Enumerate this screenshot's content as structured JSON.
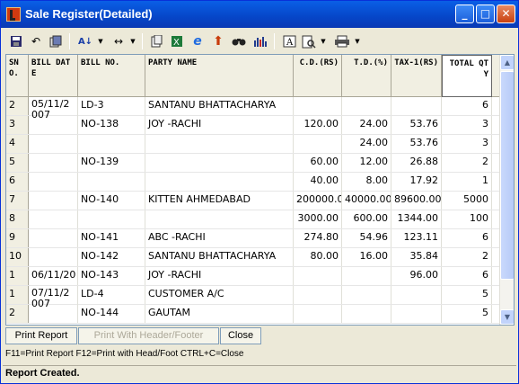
{
  "window": {
    "title": "Sale Register(Detailed)",
    "minimize_glyph": "_",
    "maximize_glyph": "□",
    "close_glyph": "✕"
  },
  "toolbar": {
    "icons": [
      "save-icon",
      "undo-icon",
      "copy-report-icon",
      "sort-icon",
      "dropdown-icon",
      "column-width-icon",
      "dropdown-icon",
      "clipboard-icon",
      "excel-icon",
      "internet-explorer-icon",
      "upload-arrow-icon",
      "find-binoculars-icon",
      "chart-icon",
      "text-format-icon",
      "print-preview-icon",
      "dropdown-icon",
      "printer-icon",
      "dropdown-icon"
    ]
  },
  "table": {
    "headers": {
      "sno": "SN O.",
      "bill_date": "BILL DATE",
      "bill_no": "BILL NO.",
      "party_name": "PARTY NAME",
      "cd": "C.D.(RS)",
      "td": "T.D.(%)",
      "tax": "TAX-1(RS)",
      "total_qty": "TOTAL QTY"
    },
    "rows": [
      {
        "sno": "2",
        "date": "05/11/2007",
        "bill": "LD-3",
        "party": "SANTANU BHATTACHARYA",
        "cd": "",
        "td": "",
        "tax": "",
        "qty": "6"
      },
      {
        "sno": "3",
        "date": "",
        "bill": "NO-138",
        "party": "JOY               -RACHI",
        "cd": "120.00",
        "td": "24.00",
        "tax": "53.76",
        "qty": "3"
      },
      {
        "sno": "4",
        "date": "",
        "bill": "",
        "party": "",
        "cd": "",
        "td": "24.00",
        "tax": "53.76",
        "qty": "3"
      },
      {
        "sno": "5",
        "date": "",
        "bill": "NO-139",
        "party": "",
        "cd": "60.00",
        "td": "12.00",
        "tax": "26.88",
        "qty": "2"
      },
      {
        "sno": "6",
        "date": "",
        "bill": "",
        "party": "",
        "cd": "40.00",
        "td": "8.00",
        "tax": "17.92",
        "qty": "1"
      },
      {
        "sno": "7",
        "date": "",
        "bill": "NO-140",
        "party": "KITTEN AHMEDABAD",
        "cd": "200000.0",
        "td": "40000.00",
        "tax": "89600.00",
        "qty": "5000"
      },
      {
        "sno": "8",
        "date": "",
        "bill": "",
        "party": "",
        "cd": "3000.00",
        "td": "600.00",
        "tax": "1344.00",
        "qty": "100"
      },
      {
        "sno": "9",
        "date": "",
        "bill": "NO-141",
        "party": "ABC               -RACHI",
        "cd": "274.80",
        "td": "54.96",
        "tax": "123.11",
        "qty": "6"
      },
      {
        "sno": "10",
        "date": "",
        "bill": "NO-142",
        "party": "SANTANU BHATTACHARYA",
        "cd": "80.00",
        "td": "16.00",
        "tax": "35.84",
        "qty": "2"
      },
      {
        "sno": "1",
        "date": "06/11/20",
        "bill": "NO-143",
        "party": "JOY               -RACHI",
        "cd": "",
        "td": "",
        "tax": "96.00",
        "qty": "6"
      },
      {
        "sno": "1",
        "date": "07/11/2007",
        "bill": "LD-4",
        "party": "CUSTOMER A/C",
        "cd": "",
        "td": "",
        "tax": "",
        "qty": "5"
      },
      {
        "sno": "2",
        "date": "",
        "bill": "NO-144",
        "party": "GAUTAM",
        "cd": "",
        "td": "",
        "tax": "",
        "qty": "5"
      }
    ]
  },
  "actions": {
    "print_report": "Print Report",
    "print_header_footer": "Print With Header/Footer",
    "close": "Close"
  },
  "hint": "F11=Print Report  F12=Print with Head/Foot  CTRL+C=Close",
  "status": "Report Created.",
  "colors": {
    "title_bar": "#0a5fe6",
    "window_bg": "#ece9d8"
  }
}
